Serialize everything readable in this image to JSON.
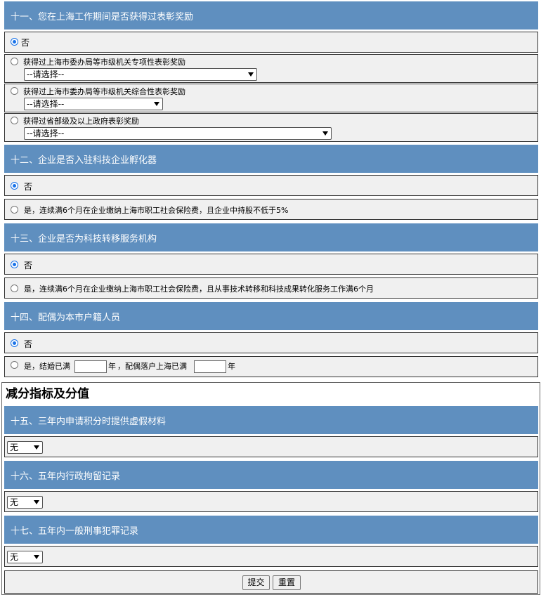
{
  "q11": {
    "title": "十一、您在上海工作期间是否获得过表彰奖励",
    "opt_no": "否",
    "opt_a": "获得过上海市委办局等市级机关专项性表彰奖励",
    "opt_b": "获得过上海市委办局等市级机关综合性表彰奖励",
    "opt_c": "获得过省部级及以上政府表彰奖励",
    "select_placeholder": "--请选择--"
  },
  "q12": {
    "title": "十二、企业是否入驻科技企业孵化器",
    "opt_no": "否",
    "opt_yes": "是，连续满6个月在企业缴纳上海市职工社会保险费，且企业中持股不低于5%"
  },
  "q13": {
    "title": "十三、企业是否为科技转移服务机构",
    "opt_no": "否",
    "opt_yes": "是，连续满6个月在企业缴纳上海市职工社会保险费，且从事技术转移和科技成果转化服务工作满6个月"
  },
  "q14": {
    "title": "十四、配偶为本市户籍人员",
    "opt_no": "否",
    "opt_yes_prefix": "是，结婚已满",
    "year1": "年",
    "mid": "，配偶落户上海已满",
    "year2": "年"
  },
  "deduct_title": "减分指标及分值",
  "q15": {
    "title": "十五、三年内申请积分时提供虚假材料",
    "value": "无"
  },
  "q16": {
    "title": "十六、五年内行政拘留记录",
    "value": "无"
  },
  "q17": {
    "title": "十七、五年内一般刑事犯罪记录",
    "value": "无"
  },
  "buttons": {
    "submit": "提交",
    "reset": "重置"
  }
}
